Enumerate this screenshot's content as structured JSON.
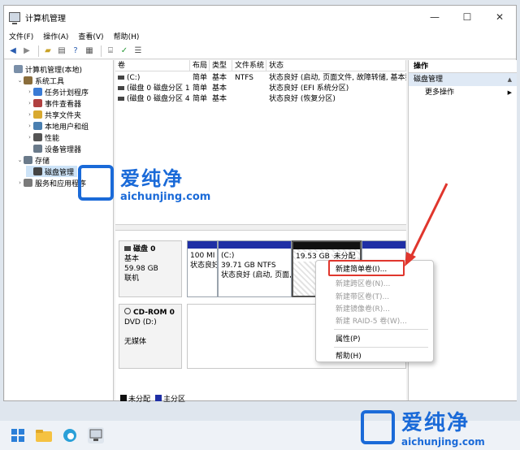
{
  "window": {
    "title": "计算机管理",
    "minimize": "—",
    "maximize": "☐",
    "close": "✕"
  },
  "menu": [
    "文件(F)",
    "操作(A)",
    "查看(V)",
    "帮助(H)"
  ],
  "toolbar_icons": [
    "back-arrow-icon",
    "forward-arrow-icon",
    "folder-up-icon",
    "properties-icon",
    "help-icon",
    "view-icon",
    "console-icon",
    "check-icon",
    "list-icon"
  ],
  "tree": [
    {
      "label": "计算机管理(本地)",
      "depth": 0,
      "twisty": "",
      "icon": "computer-icon"
    },
    {
      "label": "系统工具",
      "depth": 1,
      "twisty": "⌄",
      "icon": "tools-icon"
    },
    {
      "label": "任务计划程序",
      "depth": 2,
      "twisty": "›",
      "icon": "clock-icon"
    },
    {
      "label": "事件查看器",
      "depth": 2,
      "twisty": "›",
      "icon": "event-icon"
    },
    {
      "label": "共享文件夹",
      "depth": 2,
      "twisty": "›",
      "icon": "share-folder-icon"
    },
    {
      "label": "本地用户和组",
      "depth": 2,
      "twisty": "›",
      "icon": "users-icon"
    },
    {
      "label": "性能",
      "depth": 2,
      "twisty": "›",
      "icon": "performance-icon"
    },
    {
      "label": "设备管理器",
      "depth": 2,
      "twisty": "",
      "icon": "device-icon"
    },
    {
      "label": "存储",
      "depth": 1,
      "twisty": "⌄",
      "icon": "storage-icon"
    },
    {
      "label": "磁盘管理",
      "depth": 2,
      "twisty": "",
      "icon": "disk-icon",
      "selected": true
    },
    {
      "label": "服务和应用程序",
      "depth": 1,
      "twisty": "›",
      "icon": "services-icon"
    }
  ],
  "volume_table": {
    "headers": [
      "卷",
      "布局",
      "类型",
      "文件系统",
      "状态"
    ],
    "rows": [
      [
        "(C:)",
        "简单",
        "基本",
        "NTFS",
        "状态良好 (启动, 页面文件, 故障转储, 基本数据分区)"
      ],
      [
        "(磁盘 0 磁盘分区 1)",
        "简单",
        "基本",
        "",
        "状态良好 (EFI 系统分区)"
      ],
      [
        "(磁盘 0 磁盘分区 4)",
        "简单",
        "基本",
        "",
        "状态良好 (恢复分区)"
      ]
    ]
  },
  "disks": [
    {
      "name": "磁盘 0",
      "lines": [
        "基本",
        "59.98 GB",
        "联机"
      ]
    },
    {
      "name": "CD-ROM 0",
      "lines": [
        "DVD (D:)",
        "",
        "无媒体"
      ]
    }
  ],
  "partitions": [
    {
      "title": "",
      "lines": [
        "100 MI",
        "状态良好"
      ]
    },
    {
      "title": "(C:)",
      "lines": [
        "39.71 GB NTFS",
        "状态良好 (启动, 页面,"
      ]
    },
    {
      "title": "",
      "lines": [
        "19.53 GB",
        "未分配"
      ]
    },
    {
      "title": "",
      "lines": [
        "",
        ""
      ]
    }
  ],
  "legend": [
    {
      "label": "未分配",
      "color": "#111111"
    },
    {
      "label": "主分区",
      "color": "#1f2fa5"
    }
  ],
  "actions": {
    "header": "操作",
    "section": "磁盘管理",
    "more": "更多操作"
  },
  "context_menu": {
    "items": [
      {
        "label": "新建简单卷(I)...",
        "disabled": false
      },
      {
        "label": "新建跨区卷(N)...",
        "disabled": true
      },
      {
        "label": "新建带区卷(T)...",
        "disabled": true
      },
      {
        "label": "新建镜像卷(R)...",
        "disabled": true
      },
      {
        "label": "新建 RAID-5 卷(W)...",
        "disabled": true
      },
      {
        "label": "属性(P)",
        "disabled": false
      },
      {
        "label": "帮助(H)",
        "disabled": false
      }
    ]
  },
  "watermark": {
    "brand": "爱纯净",
    "url": "aichunjing.com",
    "color": "#1a6ad8"
  },
  "colors": {
    "accent": "#1a6ad8",
    "primary_partition": "#1f2fa5",
    "unallocated": "#111111",
    "highlight": "#e0362d"
  }
}
